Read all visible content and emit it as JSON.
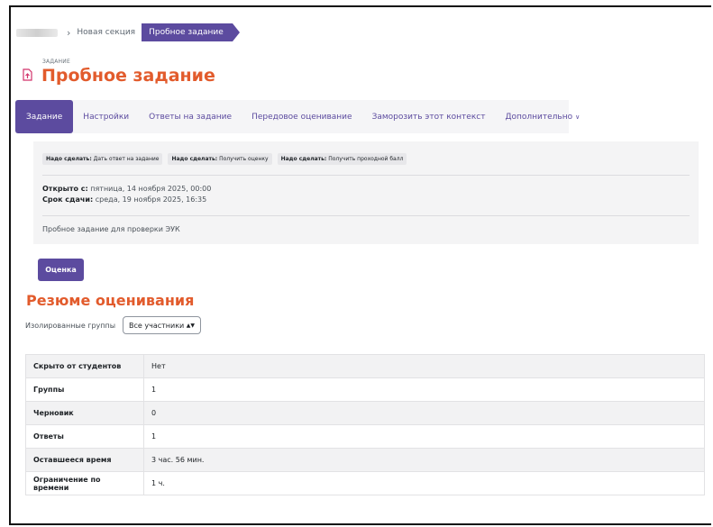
{
  "breadcrumb": {
    "items": [
      "Новая секция"
    ],
    "current": "Пробное задание"
  },
  "header": {
    "kicker": "ЗАДАНИЕ",
    "title": "Пробное задание",
    "icon": "assignment-upload-icon",
    "title_color": "#e25b2c"
  },
  "nav": {
    "tabs": [
      {
        "label": "Задание",
        "active": true
      },
      {
        "label": "Настройки"
      },
      {
        "label": "Ответы на задание"
      },
      {
        "label": "Передовое оценивание"
      },
      {
        "label": "Заморозить этот контекст"
      },
      {
        "label": "Дополнительно"
      }
    ],
    "accent": "#5c4b9f"
  },
  "todos": [
    {
      "prefix": "Надо сделать:",
      "text": "Дать ответ на задание"
    },
    {
      "prefix": "Надо сделать:",
      "text": "Получить оценку"
    },
    {
      "prefix": "Надо сделать:",
      "text": "Получить проходной балл"
    }
  ],
  "dates": {
    "opened_label": "Открыто с:",
    "opened_value": "пятница, 14 ноября 2025, 00:00",
    "due_label": "Срок сдачи:",
    "due_value": "среда, 19 ноября 2025, 16:35"
  },
  "description": "Пробное задание для проверки ЭУК",
  "grade_button": "Оценка",
  "summary": {
    "title": "Резюме оценивания",
    "group_label": "Изолированные группы",
    "group_selected": "Все участники",
    "rows": [
      {
        "key": "Скрыто от студентов",
        "value": "Нет"
      },
      {
        "key": "Группы",
        "value": "1"
      },
      {
        "key": "Черновик",
        "value": "0"
      },
      {
        "key": "Ответы",
        "value": "1"
      },
      {
        "key": "Оставшееся время",
        "value": "3 час. 56 мин."
      },
      {
        "key": "Ограничение по времени",
        "value": "1 ч."
      }
    ]
  }
}
